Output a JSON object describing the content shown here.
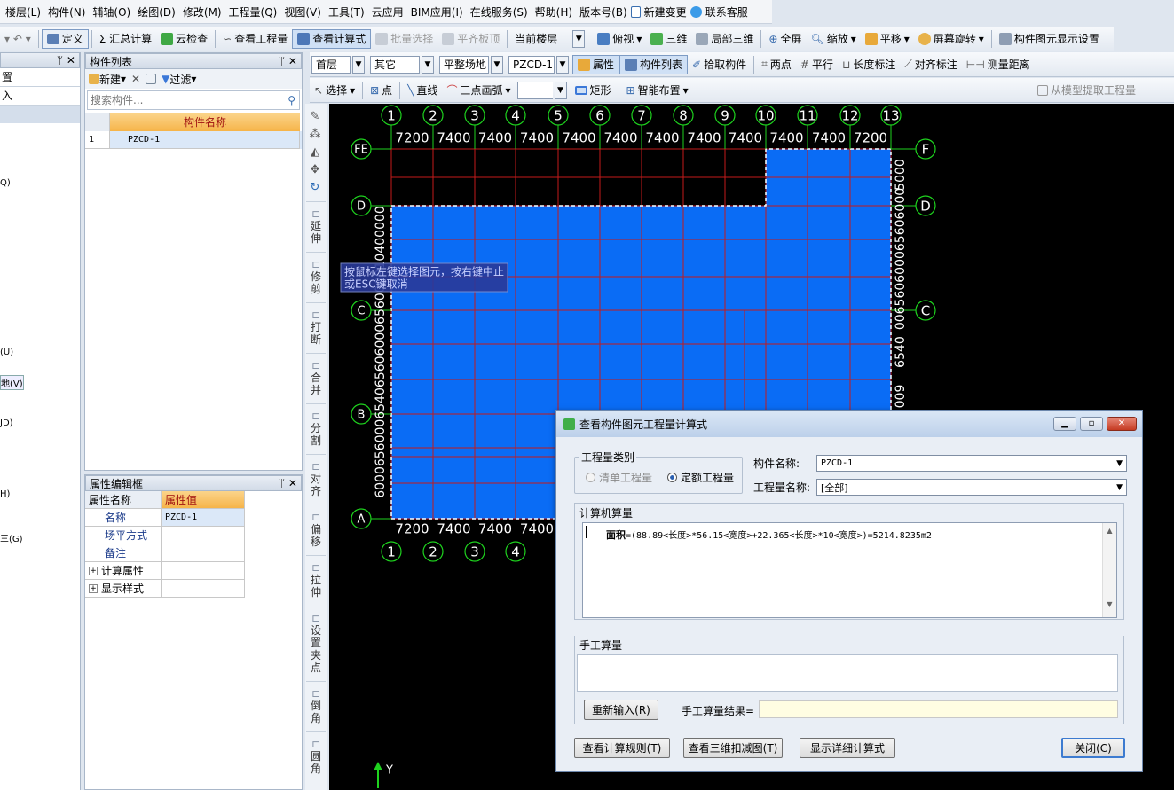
{
  "menu": [
    "楼层(L)",
    "构件(N)",
    "辅轴(O)",
    "绘图(D)",
    "修改(M)",
    "工程量(Q)",
    "视图(V)",
    "工具(T)",
    "云应用",
    "BIM应用(I)",
    "在线服务(S)",
    "帮助(H)",
    "版本号(B)",
    "新建变更",
    "联系客服"
  ],
  "toolbar1": {
    "define": "定义",
    "sum": "Σ 汇总计算",
    "cloud_check": "云检查",
    "view_qty": "查看工程量",
    "view_formula": "查看计算式",
    "batch_select": "批量选择",
    "align_slab": "平齐板顶",
    "floor_select": "当前楼层",
    "top_view": "俯视",
    "three_d": "三维",
    "local_3d": "局部三维",
    "fullscreen": "全屏",
    "zoom": "缩放",
    "pan": "平移",
    "rotate": "屏幕旋转",
    "display_settings": "构件图元显示设置"
  },
  "toolbar2": {
    "floor": "首层",
    "category": "其它",
    "type": "平整场地",
    "component": "PZCD-1",
    "props": "属性",
    "comp_list": "构件列表",
    "pick": "拾取构件",
    "two_point": "两点",
    "parallel": "平行",
    "length_dim": "长度标注",
    "align_dim": "对齐标注",
    "measure": "测量距离"
  },
  "toolbar3": {
    "select": "选择",
    "point": "点",
    "line": "直线",
    "arc": "三点画弧",
    "rect": "矩形",
    "smart": "智能布置",
    "extract": "从模型提取工程量"
  },
  "left_nav": [
    "置",
    "入",
    "Q)",
    "(U)",
    "地(V)",
    "JD)",
    "H)",
    "三(G)"
  ],
  "comp_panel": {
    "title": "构件列表",
    "new": "新建",
    "filter": "过滤",
    "search_placeholder": "搜索构件...",
    "col_header": "构件名称",
    "rows": [
      {
        "idx": "1",
        "name": "PZCD-1"
      }
    ]
  },
  "prop_panel": {
    "title": "属性编辑框",
    "col_name": "属性名称",
    "col_value": "属性值",
    "rows": [
      {
        "name": "名称",
        "value": "PZCD-1"
      },
      {
        "name": "场平方式",
        "value": ""
      },
      {
        "name": "备注",
        "value": ""
      },
      {
        "name": "计算属性",
        "value": "",
        "expand": "+"
      },
      {
        "name": "显示样式",
        "value": "",
        "expand": "+"
      }
    ]
  },
  "vtools": [
    "延伸",
    "修剪",
    "打断",
    "合并",
    "分割",
    "对齐",
    "偏移",
    "拉伸",
    "设置夹点",
    "倒角",
    "圆角"
  ],
  "canvas": {
    "top_axes": [
      "1",
      "2",
      "3",
      "4",
      "5",
      "6",
      "7",
      "8",
      "9",
      "10",
      "11",
      "12",
      "13"
    ],
    "top_dims": [
      "7200",
      "7400",
      "7400",
      "7400",
      "7400",
      "7400",
      "7400",
      "7400",
      "7400",
      "7400",
      "7400",
      "7200"
    ],
    "bottom_dims": [
      "7200",
      "7400",
      "7400",
      "7400"
    ],
    "bottom_axes": [
      "1",
      "2",
      "3",
      "4"
    ],
    "left_axes": [
      "FE",
      "D",
      "C",
      "B",
      "A"
    ],
    "right_axes": [
      "F",
      "D",
      "C"
    ],
    "left_dim_text": "6000656000654065606000656000910400000",
    "right_dim_top": "5000",
    "right_dim_mid": "006560600065606000",
    "right_dim_bot": "6540",
    "right_dim_bot2": "009",
    "tooltip_line1": "按鼠标左键选择图元，按右键中止",
    "tooltip_line2": "或ESC键取消",
    "y_axis": "Y",
    "colors": {
      "fill": "#0a6cf5",
      "grid": "#c41a1a",
      "axis": "#1ed21e"
    }
  },
  "dialog": {
    "title": "查看构件图元工程量计算式",
    "qty_type_label": "工程量类别",
    "opt_list": "清单工程量",
    "opt_quota": "定额工程量",
    "comp_name_label": "构件名称:",
    "comp_name_value": "PZCD-1",
    "qty_name_label": "工程量名称:",
    "qty_name_value": "[全部]",
    "computer_label": "计算机算量",
    "formula_bold": "面积",
    "formula_rest": "=(88.89<长度>*56.15<宽度>+22.365<长度>*10<宽度>)=5214.8235m2",
    "manual_label": "手工算量",
    "reinput": "重新输入(R)",
    "manual_result_label": "手工算量结果=",
    "btn_rules": "查看计算规则(T)",
    "btn_3d": "查看三维扣减图(T)",
    "btn_detail": "显示详细计算式",
    "btn_close": "关闭(C)"
  }
}
